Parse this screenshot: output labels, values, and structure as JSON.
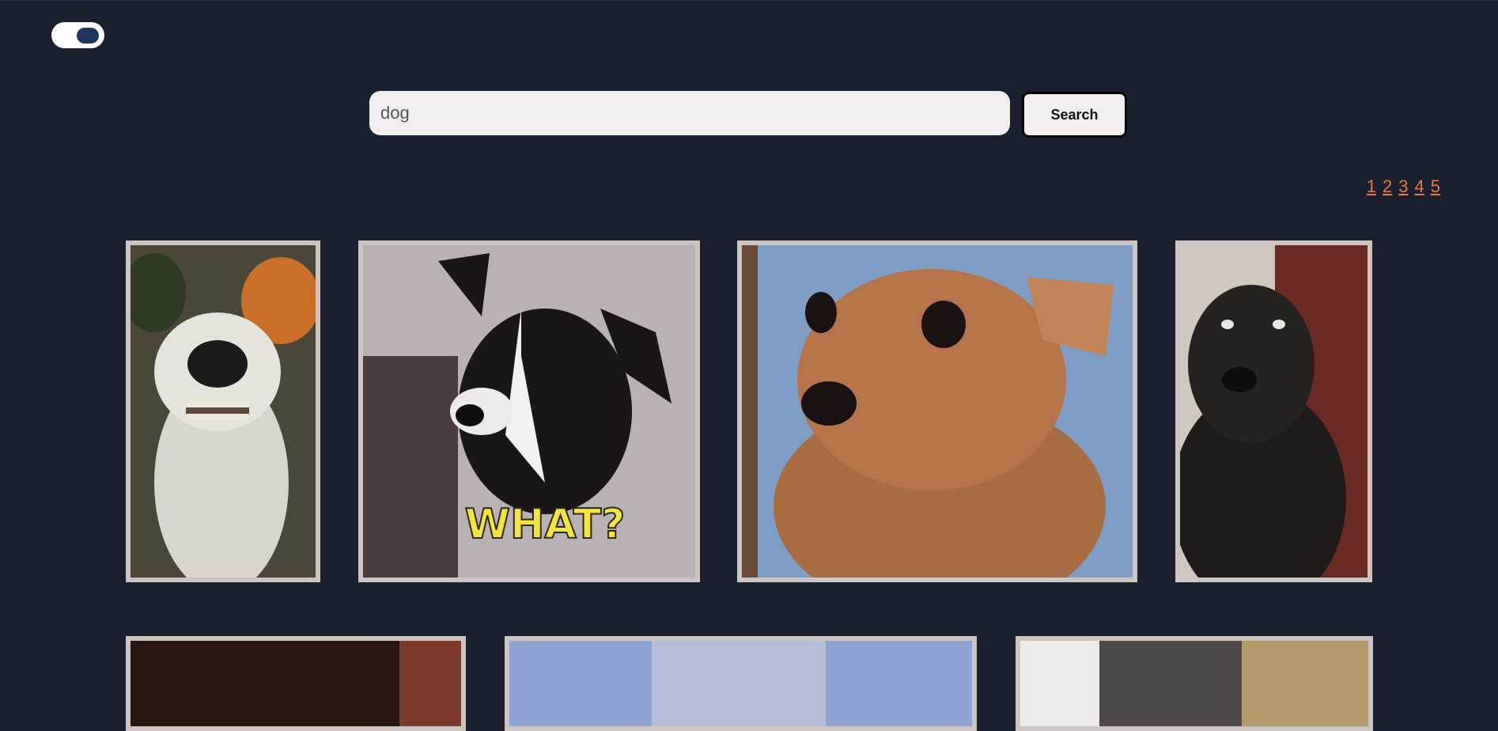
{
  "theme_toggle": {
    "state": "dark"
  },
  "search": {
    "value": "dog",
    "button_label": "Search"
  },
  "pagination": {
    "pages": [
      "1",
      "2",
      "3",
      "4",
      "5"
    ]
  },
  "gallery": {
    "gifs": [
      {
        "subject": "smiling white dog"
      },
      {
        "subject": "black and white dog",
        "caption": "WHAT?"
      },
      {
        "subject": "startled tan chihuahua"
      },
      {
        "subject": "nervous black labrador"
      },
      {
        "subject": "dark dog photo"
      },
      {
        "subject": "blurry light photo"
      },
      {
        "subject": "cat photo"
      }
    ]
  },
  "colors": {
    "background": "#1b2030",
    "accent_link": "#e5793f",
    "card_border": "#cdc4c4",
    "input_bg": "#f3eeee"
  }
}
